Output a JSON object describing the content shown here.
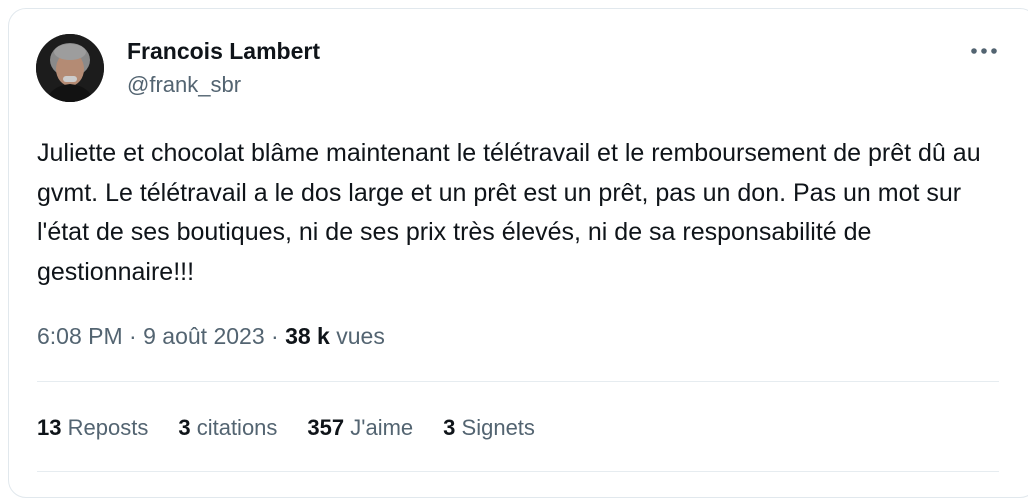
{
  "author": {
    "name": "Francois Lambert",
    "handle": "@frank_sbr"
  },
  "tweet": {
    "text": "Juliette et chocolat blâme maintenant le télétravail et le remboursement de prêt dû au gvmt. Le télétravail a le dos large et un prêt est un prêt, pas un don. Pas un mot sur l'état de ses boutiques, ni de ses prix très élevés, ni de sa responsabilité de gestionnaire!!!"
  },
  "meta": {
    "time": "6:08 PM",
    "separator": "·",
    "date": "9 août 2023",
    "views_count": "38 k",
    "views_label": "vues"
  },
  "stats": [
    {
      "count": "13",
      "label": "Reposts"
    },
    {
      "count": "3",
      "label": "citations"
    },
    {
      "count": "357",
      "label": "J'aime"
    },
    {
      "count": "3",
      "label": "Signets"
    }
  ],
  "icons": {
    "more": "more-horizontal-icon"
  }
}
